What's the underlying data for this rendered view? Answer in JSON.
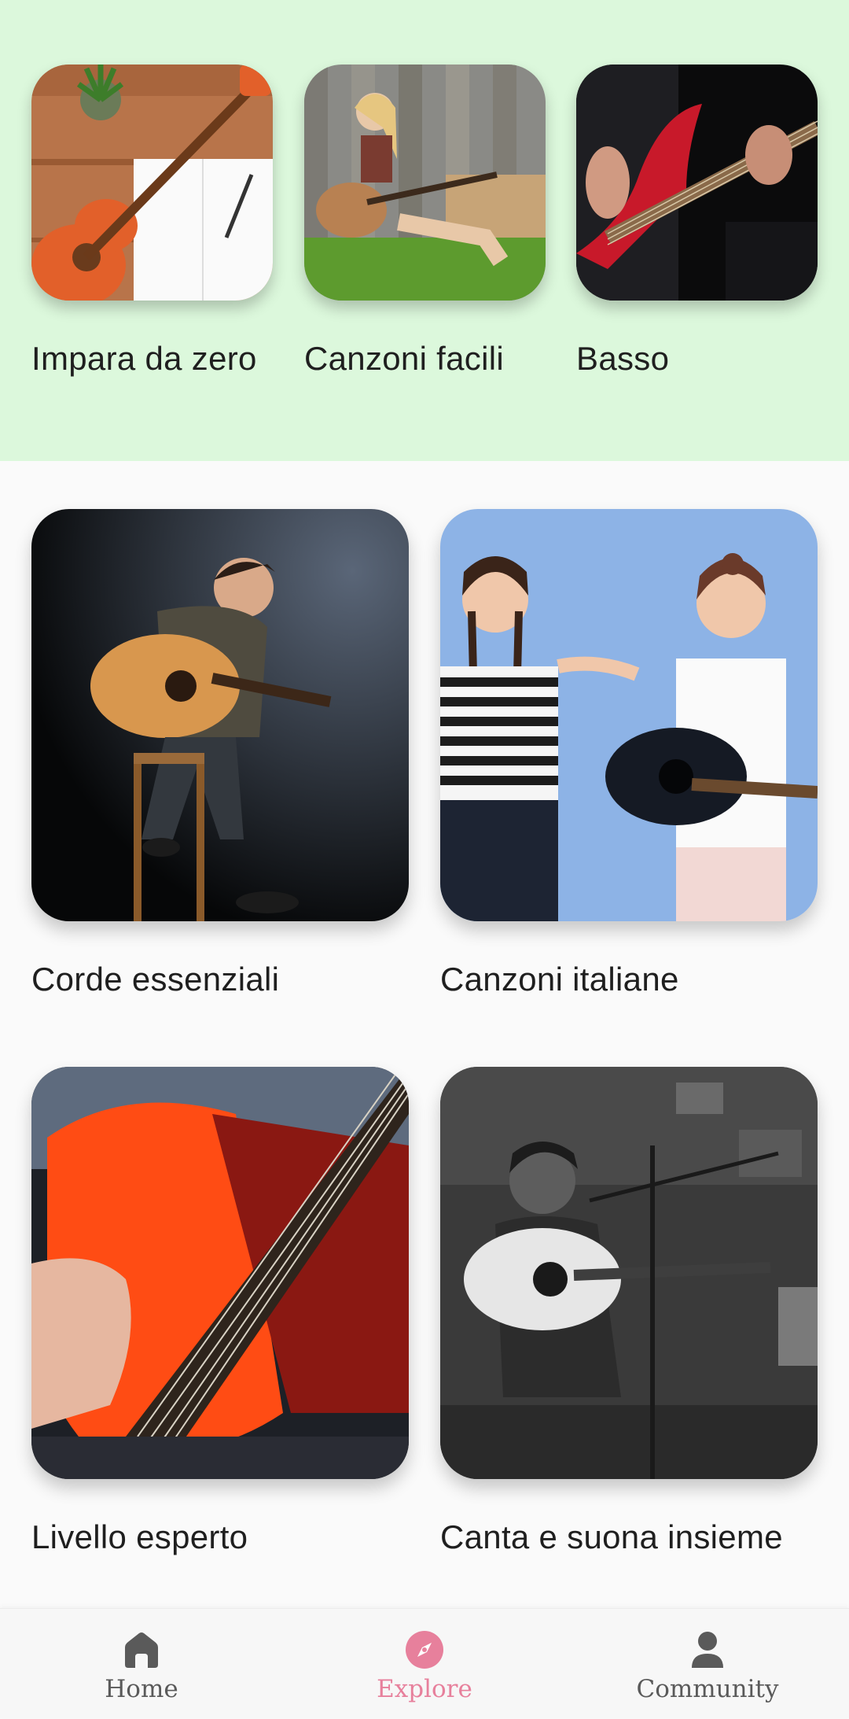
{
  "carousel": [
    {
      "label": "Impara da zero"
    },
    {
      "label": "Canzoni facili"
    },
    {
      "label": "Basso"
    }
  ],
  "grid": [
    {
      "label": "Corde essenziali"
    },
    {
      "label": "Canzoni italiane"
    },
    {
      "label": "Livello esperto"
    },
    {
      "label": "Canta e suona insieme"
    }
  ],
  "nav": {
    "items": [
      {
        "label": "Home",
        "icon": "home-icon",
        "active": false
      },
      {
        "label": "Explore",
        "icon": "compass-icon",
        "active": true
      },
      {
        "label": "Community",
        "icon": "person-icon",
        "active": false
      }
    ]
  },
  "colors": {
    "top_section_bg": "#dcf8dc",
    "accent": "#e7809c",
    "nav_inactive": "#5a5a5a"
  }
}
